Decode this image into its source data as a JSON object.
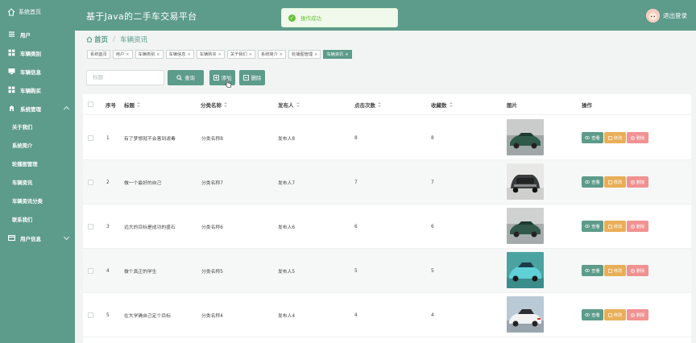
{
  "header": {
    "title": "基于Java的二手车交易平台",
    "logout_label": "退出登录"
  },
  "toast": {
    "message": "操作成功"
  },
  "sidebar": {
    "brand": "系统首页",
    "items": [
      {
        "label": "用户",
        "icon": "list-icon"
      },
      {
        "label": "车辆类别",
        "icon": "grid-icon"
      },
      {
        "label": "车辆信息",
        "icon": "monitor-icon"
      },
      {
        "label": "车辆购买",
        "icon": "grid-icon"
      },
      {
        "label": "系统管理",
        "icon": "gear-icon",
        "expanded": true
      },
      {
        "label": "用户信息",
        "icon": "card-icon"
      }
    ],
    "sub_items": [
      "关于我们",
      "系统简介",
      "轮播图管理",
      "车辆资讯",
      "车辆资讯分类",
      "联系我们"
    ]
  },
  "breadcrumb": {
    "home": "首页",
    "current": "车辆资讯"
  },
  "tabs": [
    "系统首页",
    "用户",
    "车辆类别",
    "车辆信息",
    "车辆购买",
    "关于我们",
    "系统简介",
    "轮播图管理",
    "车辆资讯"
  ],
  "toolbar": {
    "search_placeholder": "标题",
    "search_label": "查询",
    "add_label": "添加",
    "delete_label": "删除"
  },
  "table": {
    "columns": [
      "序号",
      "标题",
      "分类名称",
      "发布人",
      "点击次数",
      "收藏数",
      "图片",
      "操作"
    ],
    "rows": [
      {
        "index": "1",
        "title": "有了梦想就不会害到滤毒",
        "category": "分类名称8",
        "publisher": "发布人8",
        "clicks": "8",
        "favorites": "8"
      },
      {
        "index": "2",
        "title": "做一个最好的自己",
        "category": "分类名称7",
        "publisher": "发布人7",
        "clicks": "7",
        "favorites": "7"
      },
      {
        "index": "3",
        "title": "远大的目标是成功的盛石",
        "category": "分类名称6",
        "publisher": "发布人6",
        "clicks": "6",
        "favorites": "6"
      },
      {
        "index": "4",
        "title": "做个真正的学生",
        "category": "分类名称5",
        "publisher": "发布人5",
        "clicks": "5",
        "favorites": "5"
      },
      {
        "index": "5",
        "title": "在大学确自己定个目标",
        "category": "分类名称4",
        "publisher": "发布人4",
        "clicks": "4",
        "favorites": "4"
      }
    ],
    "actions": {
      "view": "查看",
      "edit": "修改",
      "delete": "删除"
    }
  },
  "colors": {
    "primary": "#5d9b8a",
    "warning": "#e6a23c",
    "danger": "#f08080",
    "success": "#67c23a"
  }
}
